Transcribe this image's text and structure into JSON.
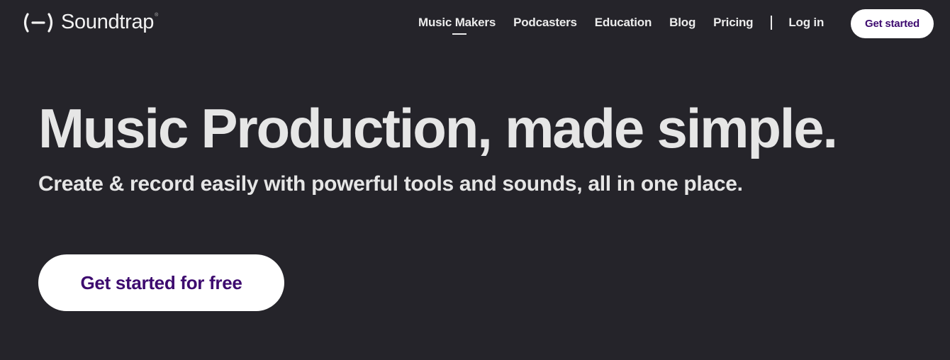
{
  "brand": {
    "name": "Soundtrap",
    "registered_mark": "®",
    "icon": "soundtrap-logo-icon"
  },
  "nav": {
    "links": [
      {
        "label": "Music Makers",
        "active": true
      },
      {
        "label": "Podcasters",
        "active": false
      },
      {
        "label": "Education",
        "active": false
      },
      {
        "label": "Blog",
        "active": false
      },
      {
        "label": "Pricing",
        "active": false
      }
    ],
    "login_label": "Log in",
    "cta_label": "Get started"
  },
  "hero": {
    "title": "Music Production, made simple.",
    "subtitle": "Create & record easily with powerful tools and sounds, all in one place.",
    "cta_label": "Get started for free"
  },
  "colors": {
    "background": "#25242a",
    "text": "#e6e6e6",
    "accent_purple": "#3d0a6f",
    "button_bg": "#ffffff"
  }
}
